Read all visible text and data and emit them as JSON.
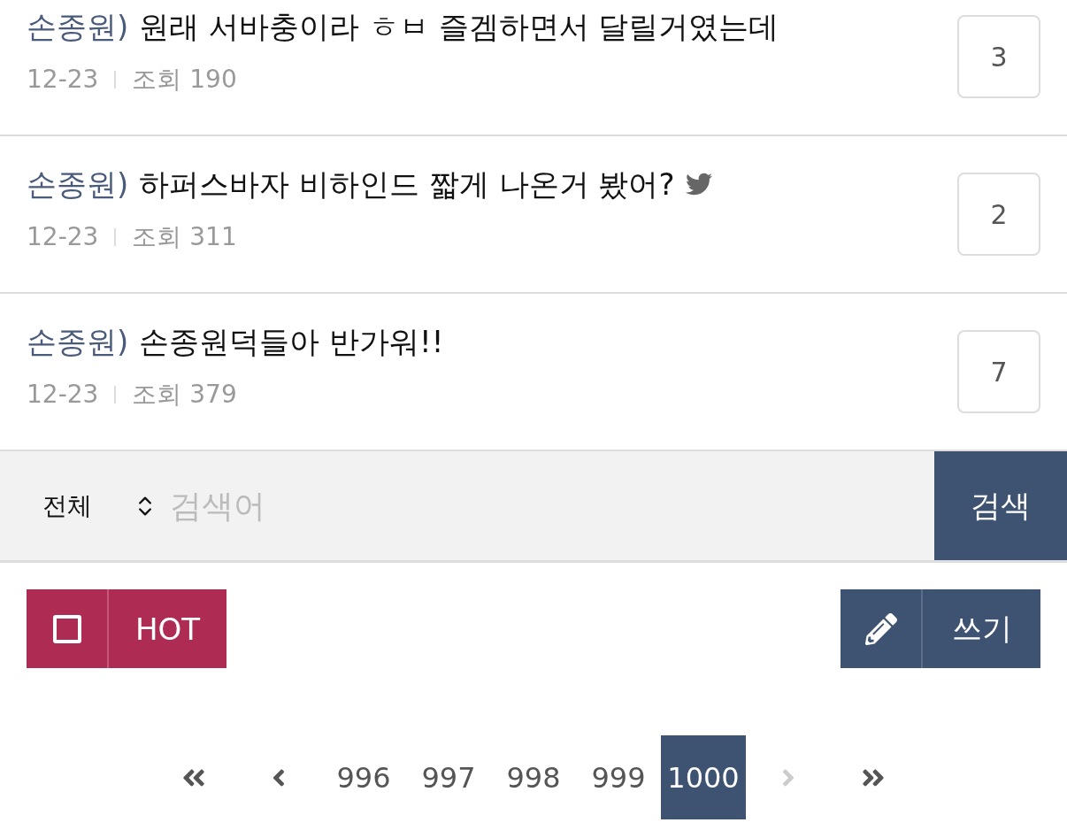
{
  "posts": [
    {
      "tag": "손종원)",
      "title": "원래 서바충이라 ㅎㅂ 즐겜하면서 달릴거였는데",
      "twitter_icon": false,
      "date": "12-23",
      "views": "조회 190",
      "comments": "3"
    },
    {
      "tag": "손종원)",
      "title": "하퍼스바자 비하인드 짧게 나온거 봤어?",
      "twitter_icon": true,
      "date": "12-23",
      "views": "조회 311",
      "comments": "2"
    },
    {
      "tag": "손종원)",
      "title": "손종원덕들아 반가워!!",
      "twitter_icon": false,
      "date": "12-23",
      "views": "조회 379",
      "comments": "7"
    }
  ],
  "search": {
    "scope": "전체",
    "placeholder": "검색어",
    "button": "검색"
  },
  "hot_button": {
    "label": "HOT",
    "checked": false
  },
  "write_button": {
    "label": "쓰기"
  },
  "pagination": [
    {
      "kind": "first",
      "disabled": false
    },
    {
      "kind": "prev",
      "disabled": false
    },
    {
      "kind": "page",
      "label": "996",
      "selected": false
    },
    {
      "kind": "page",
      "label": "997",
      "selected": false
    },
    {
      "kind": "page",
      "label": "998",
      "selected": false
    },
    {
      "kind": "page",
      "label": "999",
      "selected": false
    },
    {
      "kind": "page",
      "label": "1000",
      "selected": true
    },
    {
      "kind": "next",
      "disabled": true
    },
    {
      "kind": "last",
      "disabled": false
    }
  ]
}
